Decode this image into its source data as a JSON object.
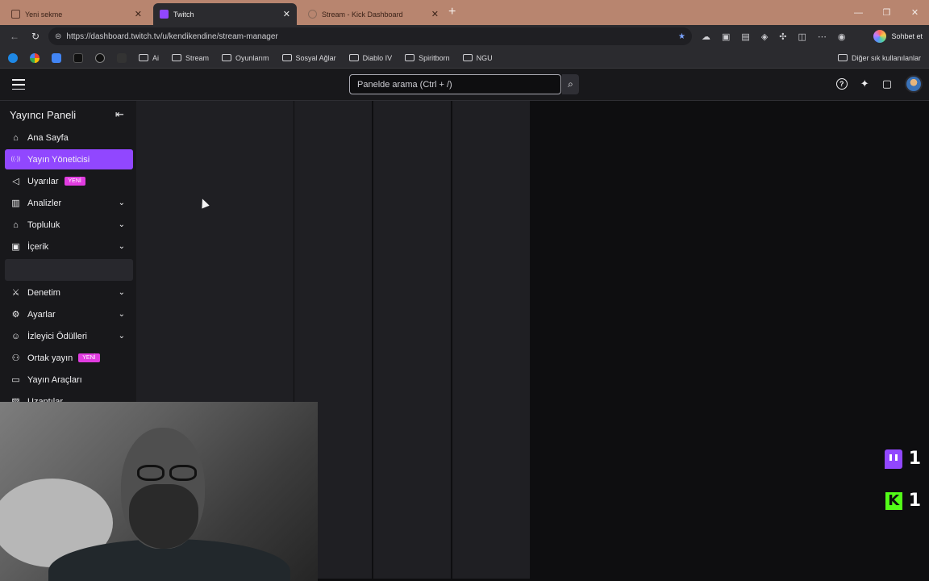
{
  "browser": {
    "tabs": [
      {
        "title": "Yeni sekme",
        "active": false,
        "favicon_color": "#7a5a4a"
      },
      {
        "title": "Twitch",
        "active": true,
        "favicon_color": "#9147ff"
      },
      {
        "title": "Stream - Kick Dashboard",
        "active": false,
        "favicon_color": "#8a6a5a"
      }
    ],
    "url": "https://dashboard.twitch.tv/u/kendikendine/stream-manager",
    "sohbet_label": "Sohbet et"
  },
  "bookmarks": {
    "folders": [
      "Ai",
      "Stream",
      "Oyunlarım",
      "Sosyal Ağlar",
      "Diablo IV",
      "Spiritborn",
      "NGU"
    ],
    "other_label": "Diğer sık kullanılanlar"
  },
  "topnav": {
    "search_placeholder": "Panelde arama (Ctrl + /)"
  },
  "sidebar": {
    "title": "Yayıncı Paneli",
    "items": [
      {
        "label": "Ana Sayfa",
        "icon": "home-icon",
        "glyph": "⌂",
        "badge": "",
        "chevron": false,
        "active": false
      },
      {
        "label": "Yayın Yöneticisi",
        "icon": "broadcast-icon",
        "glyph": "((·))",
        "badge": "",
        "chevron": false,
        "active": true
      },
      {
        "label": "Uyarılar",
        "icon": "megaphone-icon",
        "glyph": "◁",
        "badge": "YENİ",
        "chevron": false,
        "active": false
      },
      {
        "label": "Analizler",
        "icon": "analytics-icon",
        "glyph": "▥",
        "badge": "",
        "chevron": true,
        "active": false
      },
      {
        "label": "Topluluk",
        "icon": "community-icon",
        "glyph": "⌂",
        "badge": "",
        "chevron": true,
        "active": false
      },
      {
        "label": "İçerik",
        "icon": "content-icon",
        "glyph": "▣",
        "badge": "",
        "chevron": true,
        "active": false
      },
      {
        "label": "Denetim",
        "icon": "sword-icon",
        "glyph": "⚔",
        "badge": "",
        "chevron": true,
        "active": false
      },
      {
        "label": "Ayarlar",
        "icon": "gear-icon",
        "glyph": "⚙",
        "badge": "",
        "chevron": true,
        "active": false
      },
      {
        "label": "İzleyici Ödülleri",
        "icon": "rewards-icon",
        "glyph": "☺",
        "badge": "",
        "chevron": true,
        "active": false
      },
      {
        "label": "Ortak yayın",
        "icon": "collab-icon",
        "glyph": "⚇",
        "badge": "YENİ",
        "chevron": false,
        "active": false
      },
      {
        "label": "Yayın Araçları",
        "icon": "video-icon",
        "glyph": "▭",
        "badge": "",
        "chevron": false,
        "active": false
      },
      {
        "label": "Uzantılar",
        "icon": "extensions-icon",
        "glyph": "▨",
        "badge": "",
        "chevron": false,
        "active": false
      }
    ]
  },
  "overlay": {
    "twitch_viewers": "1",
    "kick_viewers": "1",
    "kick_letter": "K"
  },
  "colors": {
    "twitch_purple": "#9147ff",
    "kick_green": "#53fc18",
    "badge_pink": "#e13ce0"
  }
}
